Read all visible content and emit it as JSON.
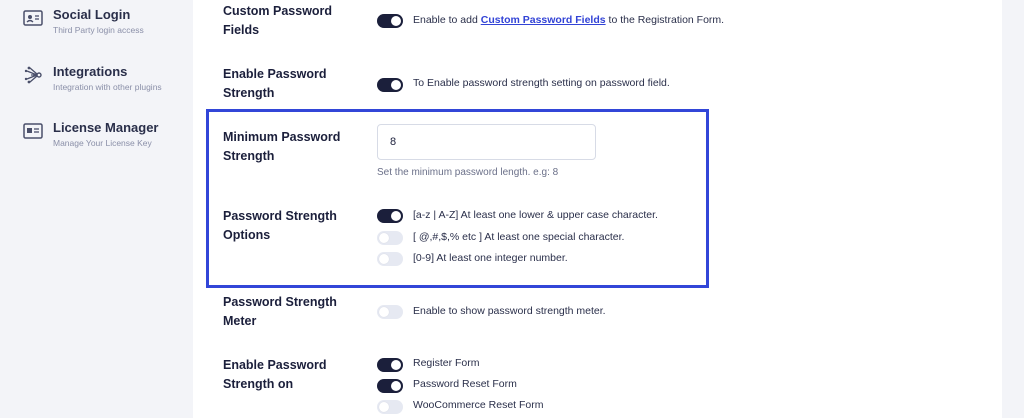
{
  "sidebar": {
    "items": [
      {
        "title": "Social Login",
        "subtitle": "Third Party login access",
        "icon": "id-card-icon"
      },
      {
        "title": "Integrations",
        "subtitle": "Integration with other plugins",
        "icon": "integrations-icon"
      },
      {
        "title": "License Manager",
        "subtitle": "Manage Your License Key",
        "icon": "license-card-icon"
      }
    ]
  },
  "settings": {
    "custom_password_fields": {
      "label": "Custom Password Fields",
      "enabled": true,
      "desc_pre": "Enable to add ",
      "desc_link": "Custom Password Fields",
      "desc_post": " to the Registration Form."
    },
    "enable_password_strength": {
      "label": "Enable Password Strength",
      "enabled": true,
      "desc": "To Enable password strength setting on password field."
    },
    "minimum_password_strength": {
      "label": "Minimum Password Strength",
      "value": "8",
      "hint": "Set the minimum password length. e.g: 8"
    },
    "password_strength_options": {
      "label": "Password Strength Options",
      "options": [
        {
          "text": "[a-z | A-Z] At least one lower & upper case character.",
          "enabled": true
        },
        {
          "text": "[ @,#,$,% etc ] At least one special character.",
          "enabled": false
        },
        {
          "text": "[0-9] At least one integer number.",
          "enabled": false
        }
      ]
    },
    "password_strength_meter": {
      "label": "Password Strength Meter",
      "enabled": false,
      "desc": "Enable to show password strength meter."
    },
    "enable_password_strength_on": {
      "label": "Enable Password Strength on",
      "options": [
        {
          "text": "Register Form",
          "enabled": true
        },
        {
          "text": "Password Reset Form",
          "enabled": true
        },
        {
          "text": "WooCommerce Reset Form",
          "enabled": false
        }
      ]
    }
  },
  "colors": {
    "accent": "#3246d8",
    "toggle_on": "#1b1f3b",
    "toggle_off": "#e6e9f2",
    "link": "#3243d6"
  }
}
